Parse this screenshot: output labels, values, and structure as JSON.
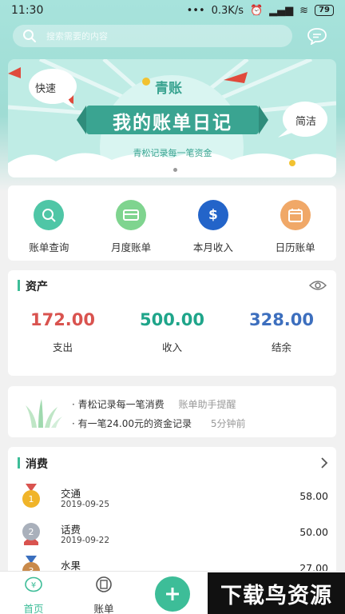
{
  "status": {
    "time": "11:30",
    "dots": "•••",
    "speed": "0.3K/s",
    "battery": "79"
  },
  "search": {
    "placeholder": "搜索需要的内容"
  },
  "banner": {
    "brand": "青账",
    "bubble_left": "快速",
    "bubble_right": "简洁",
    "title": "我的账单日记",
    "subtitle": "青松记录每一笔资金"
  },
  "quick": [
    {
      "label": "账单查询",
      "color": "#4fc6a6"
    },
    {
      "label": "月度账单",
      "color": "#7fd48f"
    },
    {
      "label": "本月收入",
      "color": "#2364c9"
    },
    {
      "label": "日历账单",
      "color": "#f0a868"
    }
  ],
  "assets": {
    "title": "资产",
    "items": [
      {
        "value": "172.00",
        "label": "支出",
        "color": "#d9534f"
      },
      {
        "value": "500.00",
        "label": "收入",
        "color": "#1fa58a"
      },
      {
        "value": "328.00",
        "label": "结余",
        "color": "#3d6fbe"
      }
    ]
  },
  "tips": [
    {
      "text": "· 青松记录每一笔消费",
      "meta": "账单助手提醒"
    },
    {
      "text": "· 有一笔24.00元的资金记录",
      "meta": "5分钟前"
    }
  ],
  "consume": {
    "title": "消费",
    "rows": [
      {
        "name": "交通",
        "date": "2019-09-25",
        "amount": "58.00",
        "medal": "1"
      },
      {
        "name": "话费",
        "date": "2019-09-22",
        "amount": "50.00",
        "medal": "2"
      },
      {
        "name": "水果",
        "date": "",
        "amount": "27.00",
        "medal": "3"
      }
    ]
  },
  "tabs": {
    "home": "首页",
    "bill": "账单"
  },
  "watermark": "下载鸟资源"
}
